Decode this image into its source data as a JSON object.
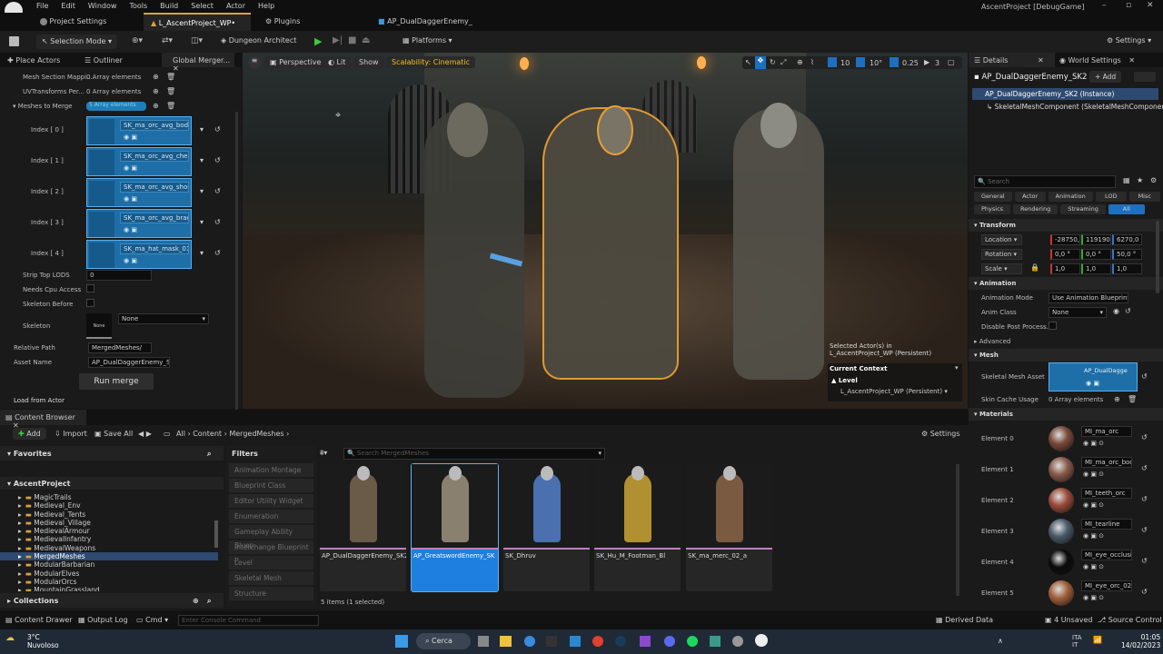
{
  "app": {
    "title": "AscentProject [DebugGame]",
    "menu": [
      "File",
      "Edit",
      "Window",
      "Tools",
      "Build",
      "Select",
      "Actor",
      "Help"
    ]
  },
  "tabs": [
    {
      "label": "Project Settings"
    },
    {
      "label": "L_AscentProject_WP•"
    },
    {
      "label": "Plugins"
    },
    {
      "label": "AP_DualDaggerEnemy_"
    }
  ],
  "toolbar": {
    "selection_mode": "Selection Mode",
    "dungeon": "Dungeon Architect",
    "platforms": "Platforms",
    "settings": "Settings"
  },
  "left_panel": {
    "tabs": [
      "Place Actors",
      "Outliner",
      "Global Merger..."
    ],
    "rows": [
      {
        "label": "Mesh Section Mappi...",
        "value": "0 Array elements"
      },
      {
        "label": "UVTransforms Per...",
        "value": "0 Array elements"
      }
    ],
    "meshes_label": "Meshes to Merge",
    "meshes_value": "5 Array elements",
    "indices": [
      {
        "label": "Index [ 0 ]",
        "asset": "SK_ma_orc_avg_bod"
      },
      {
        "label": "Index [ 1 ]",
        "asset": "SK_ma_orc_avg_ches"
      },
      {
        "label": "Index [ 2 ]",
        "asset": "SK_ma_orc_avg_shou"
      },
      {
        "label": "Index [ 3 ]",
        "asset": "SK_ma_orc_avg_brac"
      },
      {
        "label": "Index [ 4 ]",
        "asset": "SK_ma_hat_mask_01"
      }
    ],
    "strip_lods": "Strip Top LODS",
    "strip_lods_value": "0",
    "gpu_access": "Needs Cpu Access",
    "skeleton_before": "Skeleton Before",
    "skeleton": "Skeleton",
    "skeleton_none": "None",
    "skeleton_value": "None",
    "relative_path": "Relative Path",
    "relative_path_value": "MergedMeshes/",
    "asset_name": "Asset Name",
    "asset_name_value": "AP_DualDaggerEnemy_SK2",
    "run_merge": "Run merge",
    "load_from_actor": "Load from Actor"
  },
  "viewport": {
    "perspective": "Perspective",
    "lit": "Lit",
    "show": "Show",
    "scalability": "Scalability: Cinematic",
    "grid": "10",
    "angle": "10°",
    "scale": "0.25",
    "cam": "3",
    "selected": "Selected Actor(s) in",
    "selected_level": "L_AscentProject_WP (Persistent)",
    "context": "Current Context",
    "level": "Level",
    "level_value": "L_AscentProject_WP (Persistent)"
  },
  "details": {
    "tab": "Details",
    "world": "World Settings",
    "actor": "AP_DualDaggerEnemy_SK2",
    "add": "+ Add",
    "instance": "AP_DualDaggerEnemy_SK2 (Instance)",
    "component": "SkeletalMeshComponent (SkeletalMeshComponent)",
    "search": "Search",
    "filters1": [
      "General",
      "Actor",
      "Animation",
      "LOD",
      "Misc"
    ],
    "filters2": [
      "Physics",
      "Rendering",
      "Streaming",
      "All"
    ],
    "transform": "Transform",
    "location": "Location",
    "loc": [
      "-28750,",
      "119190",
      "6270,0"
    ],
    "rotation": "Rotation",
    "rot": [
      "0,0 °",
      "0,0 °",
      "50,0 °"
    ],
    "scale": "Scale",
    "scl": [
      "1,0",
      "1,0",
      "1,0"
    ],
    "animation": "Animation",
    "anim_mode": "Animation Mode",
    "anim_mode_value": "Use Animation Blueprint",
    "anim_class": "Anim Class",
    "anim_class_value": "None",
    "disable_post": "Disable Post Process...",
    "advanced": "Advanced",
    "mesh": "Mesh",
    "skel_mesh_asset": "Skeletal Mesh Asset",
    "skel_mesh_value": "AP_DualDagge",
    "skin_cache": "Skin Cache Usage",
    "skin_cache_value": "0 Array elements",
    "materials": "Materials",
    "elements": [
      {
        "label": "Element 0",
        "mat": "MI_ma_orc",
        "color": "#7a4a3a"
      },
      {
        "label": "Element 1",
        "mat": "MI_ma_orc_body",
        "color": "#8a5a4a"
      },
      {
        "label": "Element 2",
        "mat": "MI_teeth_orc",
        "color": "#9a4a3a"
      },
      {
        "label": "Element 3",
        "mat": "MI_tearline",
        "color": "#4a5a6a"
      },
      {
        "label": "Element 4",
        "mat": "MI_eye_occlusion_he",
        "color": "#0a0a0a"
      },
      {
        "label": "Element 5",
        "mat": "MI_eye_orc_02",
        "color": "#a0603a"
      }
    ]
  },
  "content_browser": {
    "tab": "Content Browser",
    "add": "Add",
    "import": "Import",
    "save_all": "Save All",
    "crumbs": [
      "All",
      "Content",
      "MergedMeshes"
    ],
    "settings": "Settings",
    "favorites": "Favorites",
    "project": "AscentProject",
    "tree": [
      "MagicTrails",
      "Medieval_Env",
      "Medieval_Tents",
      "Medieval_Village",
      "MedievalArmour",
      "MedievalInfantry",
      "MedievalWeapons",
      "MergedMeshes",
      "ModularBarbarian",
      "ModularElves",
      "ModularOrcs",
      "MountainGrassland"
    ],
    "collections": "Collections",
    "filters_title": "Filters",
    "filters": [
      "Animation Montage",
      "Blueprint Class",
      "Editor Utility Widget",
      "Enumeration",
      "Gameplay Ability Bluep",
      "Interchange Blueprint P",
      "Level",
      "Skeletal Mesh",
      "Structure"
    ],
    "search": "Search MergedMeshes",
    "assets": [
      "AP_DualDaggerEnemy_SK2",
      "AP_GreatswordEnemy_SK",
      "SK_Dhruv",
      "SK_Hu_M_Footman_Bl",
      "SK_ma_merc_02_a"
    ],
    "count": "5 items (1 selected)"
  },
  "status": {
    "drawer": "Content Drawer",
    "output": "Output Log",
    "cmd": "Cmd",
    "console": "Enter Console Command",
    "derived": "Derived Data",
    "unsaved": "4 Unsaved",
    "source": "Source Control"
  },
  "taskbar": {
    "temp": "3°C",
    "weather": "Nuvoloso",
    "search": "Cerca",
    "lang": "ITA",
    "lang2": "IT",
    "time": "01:05",
    "date": "14/02/2023"
  }
}
